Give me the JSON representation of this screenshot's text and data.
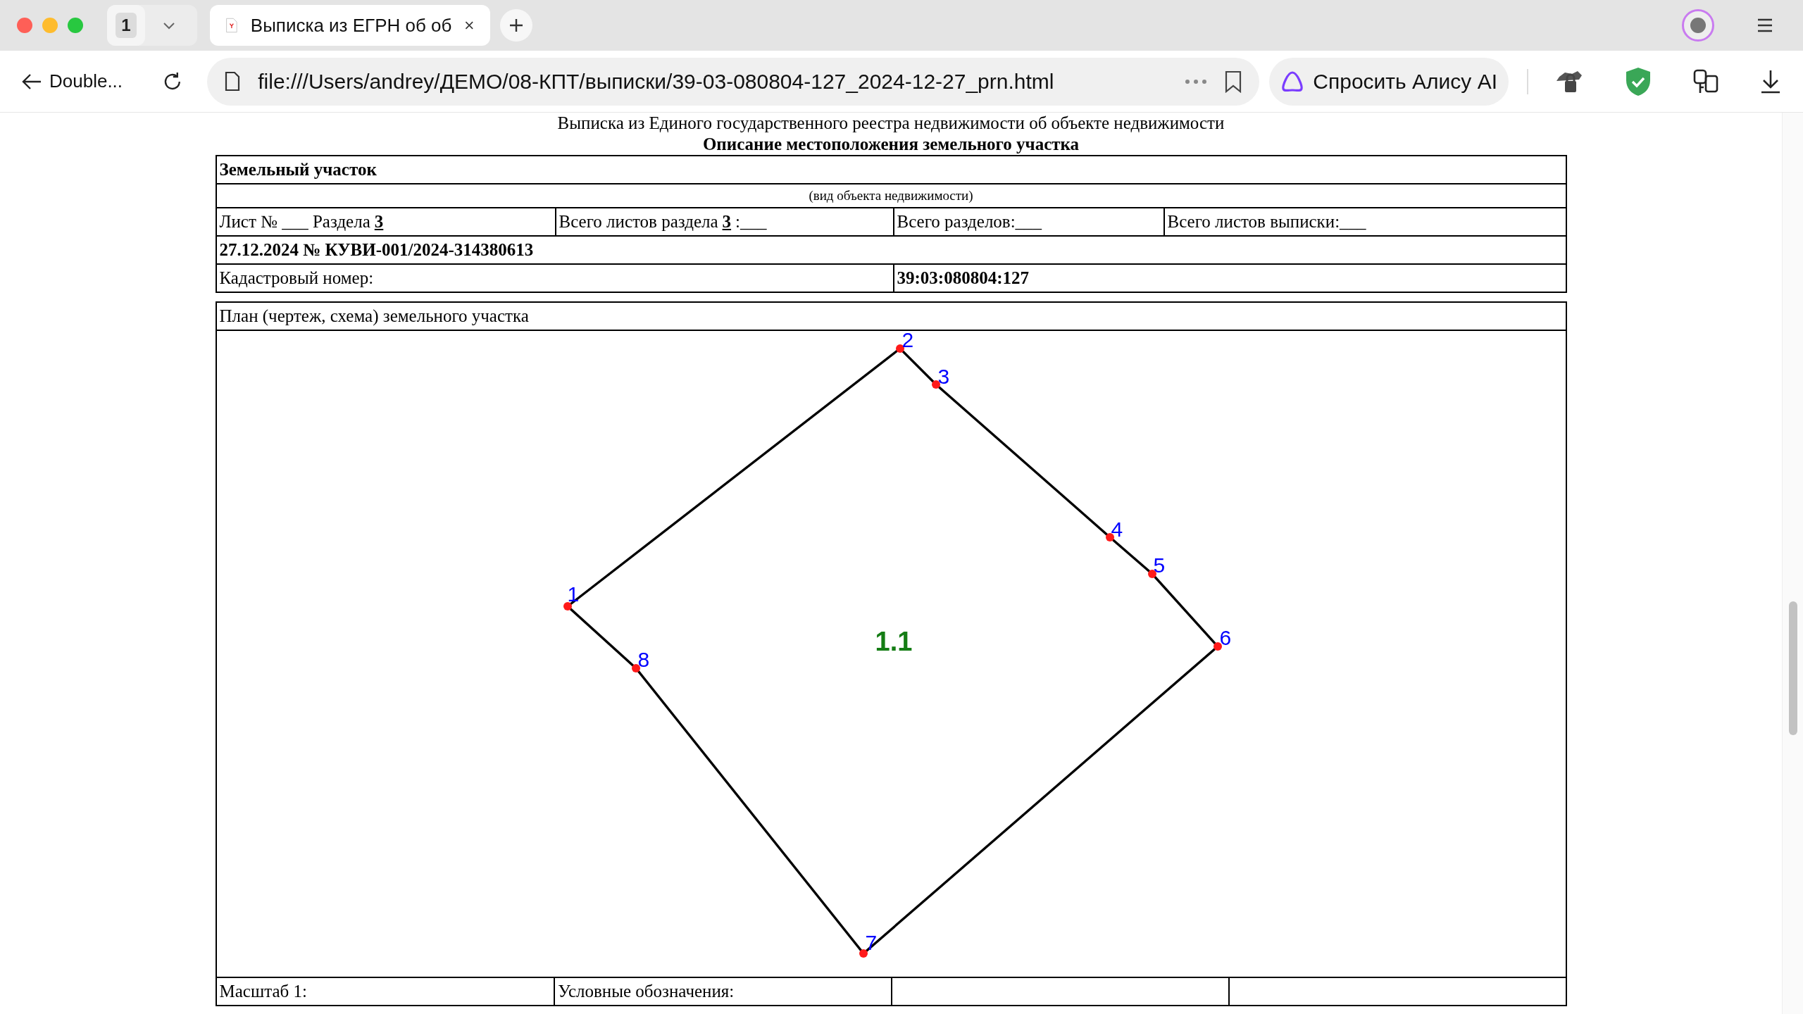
{
  "browser": {
    "tab_count": "1",
    "tabs": [
      {
        "title": "Выписка из ЕГРН об об",
        "selected": true
      }
    ],
    "back_label": "Double...",
    "url": "file:///Users/andrey/ДЕМО/08-КПТ/выписки/39-03-080804-127_2024-12-27_prn.html",
    "alice_button": "Спросить Алису AI"
  },
  "document": {
    "title": "Выписка из Единого государственного реестра недвижимости об объекте недвижимости",
    "subtitle": "Описание местоположения земельного участка",
    "object_type": "Земельный участок",
    "object_type_caption": "(вид объекта недвижимости)",
    "sheet_cells": [
      {
        "label": "Лист № ___ Раздела",
        "value": "3"
      },
      {
        "label": "Всего листов раздела",
        "value": "3",
        "suffix": ":___"
      },
      {
        "label": "Всего разделов:___"
      },
      {
        "label": "Всего листов выписки:___"
      }
    ],
    "statement_number": "27.12.2024 № КУВИ-001/2024-314380613",
    "cadastral_label": "Кадастровый номер:",
    "cadastral_number": "39:03:080804:127",
    "plan_title": "План (чертеж, схема) земельного участка",
    "parcel_label": "1.1",
    "points": [
      {
        "label": "1"
      },
      {
        "label": "2"
      },
      {
        "label": "3"
      },
      {
        "label": "4"
      },
      {
        "label": "5"
      },
      {
        "label": "6"
      },
      {
        "label": "7"
      },
      {
        "label": "8"
      }
    ],
    "footer_cells": [
      "Масштаб 1:",
      "Условные обозначения:"
    ]
  }
}
